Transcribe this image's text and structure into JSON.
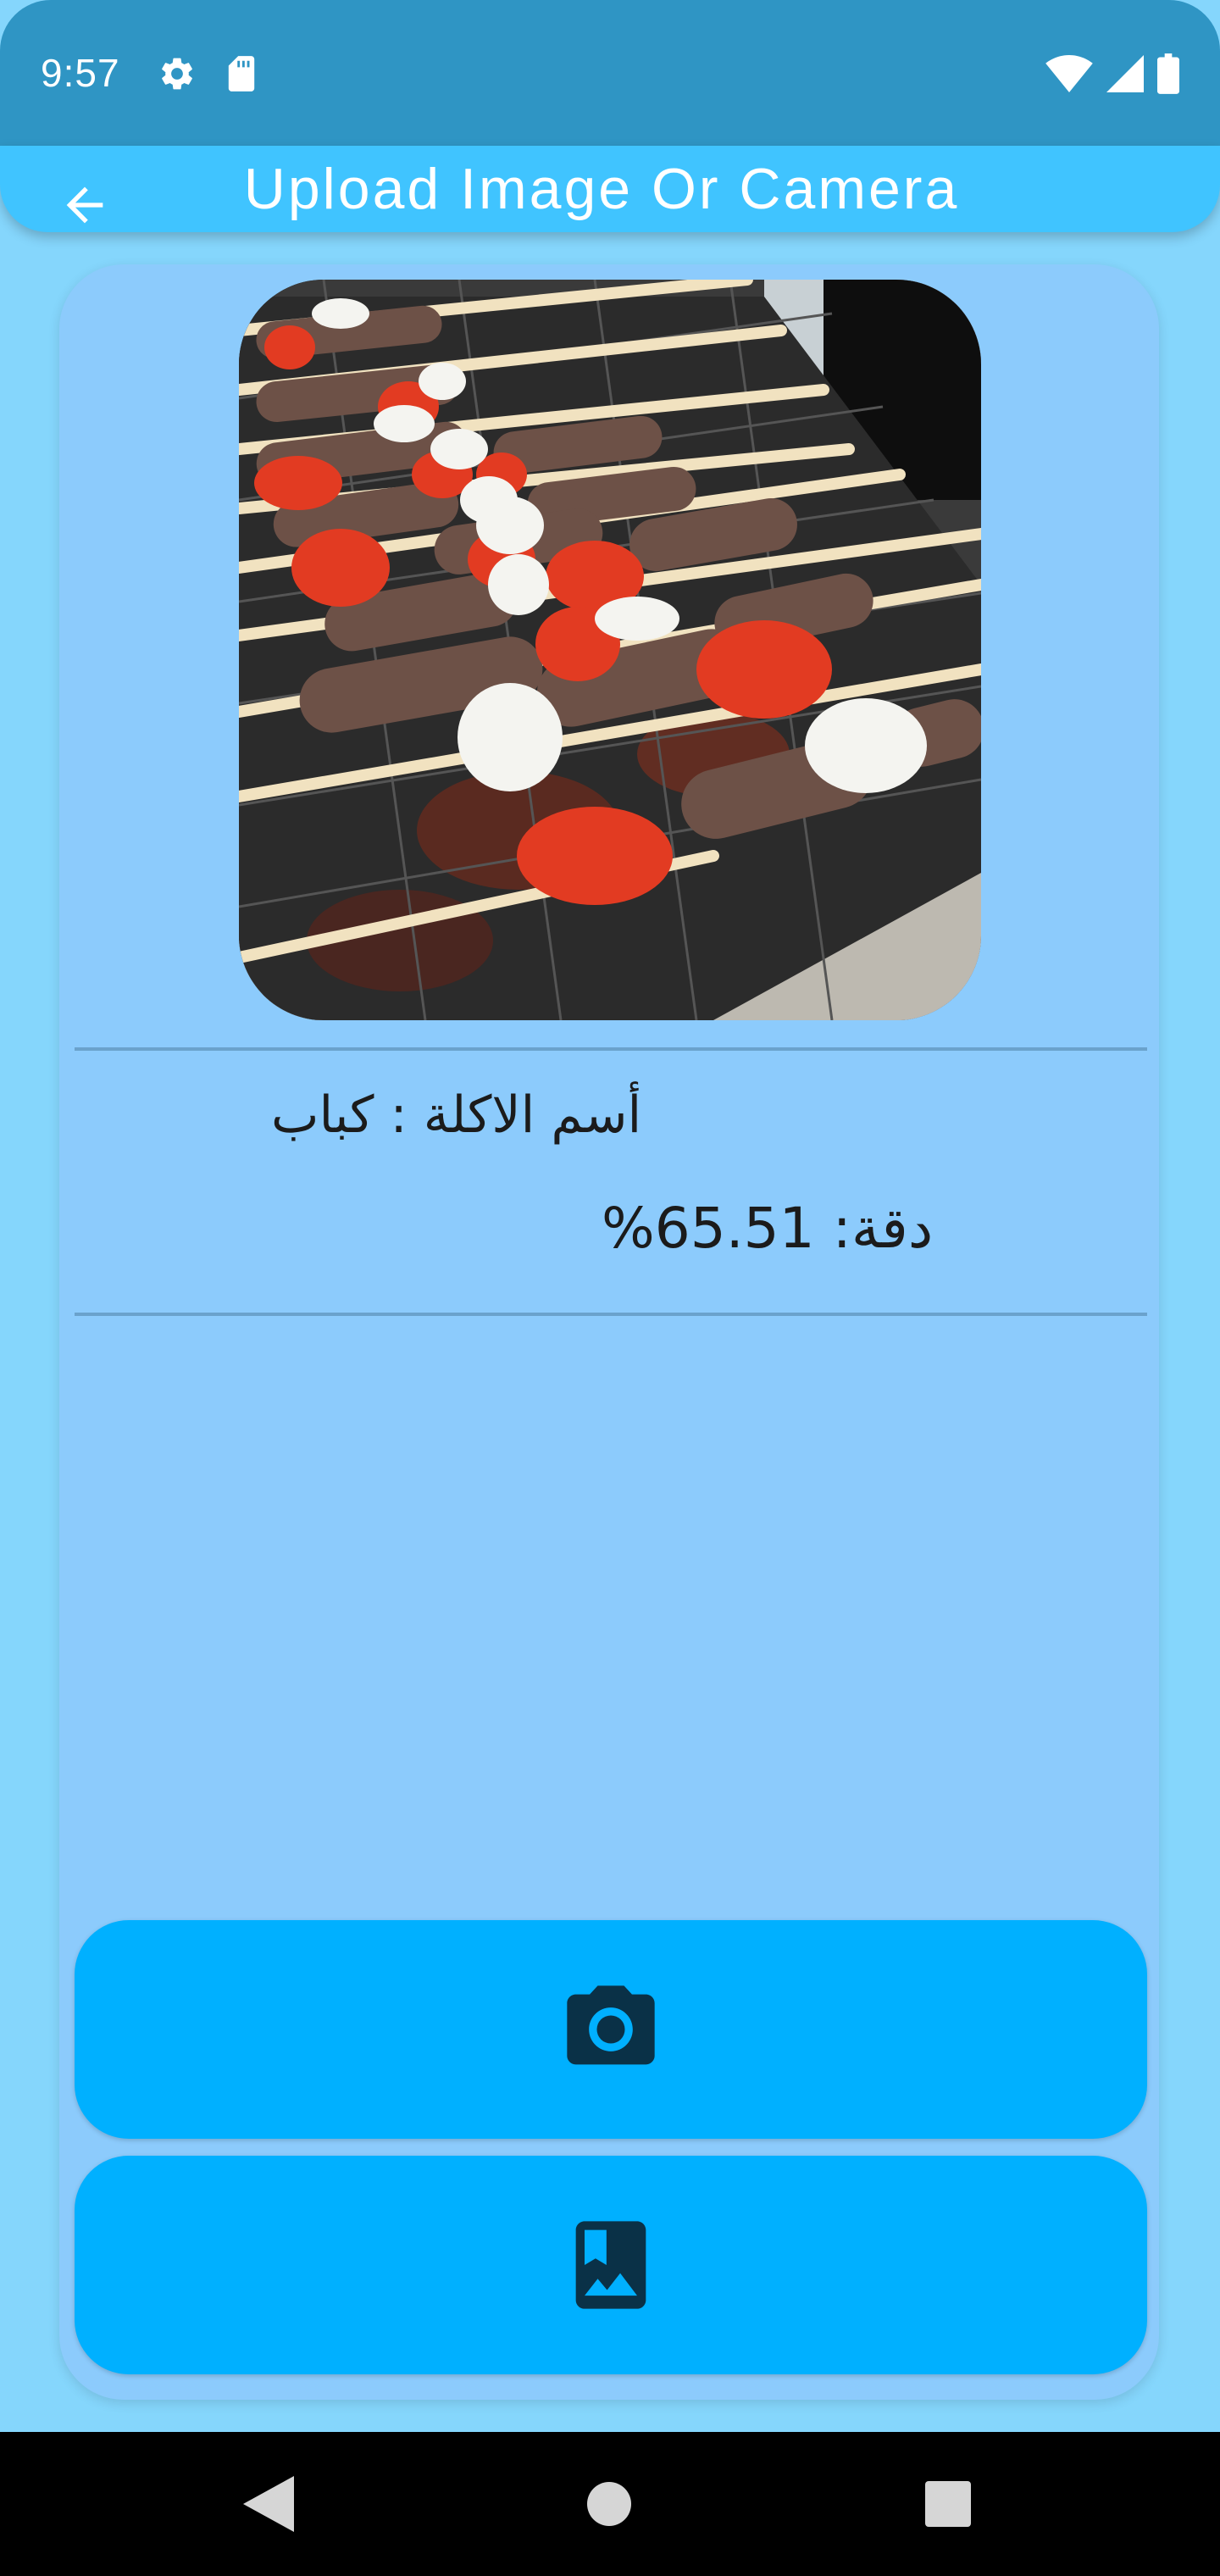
{
  "status_bar": {
    "time": "9:57",
    "icons": [
      "settings-icon",
      "sd-card-icon",
      "wifi-icon",
      "signal-icon",
      "battery-icon"
    ]
  },
  "app_bar": {
    "title": "Upload Image Or Camera",
    "back_icon": "arrow-back-icon",
    "color": "#40c4ff"
  },
  "result": {
    "name_text": "أسم الاكلة  : كباب",
    "accuracy_text": "%دقة: 65.51"
  },
  "actions": {
    "camera_icon": "camera-icon",
    "gallery_icon": "photo-album-icon",
    "button_color": "#00b0ff"
  },
  "navigation": {
    "back_icon": "nav-back-icon",
    "home_icon": "nav-home-icon",
    "recents_icon": "nav-recents-icon"
  },
  "colors": {
    "status_bar": "#2f95c4",
    "background": "#85d6fc",
    "card": "#8ccbfc"
  }
}
